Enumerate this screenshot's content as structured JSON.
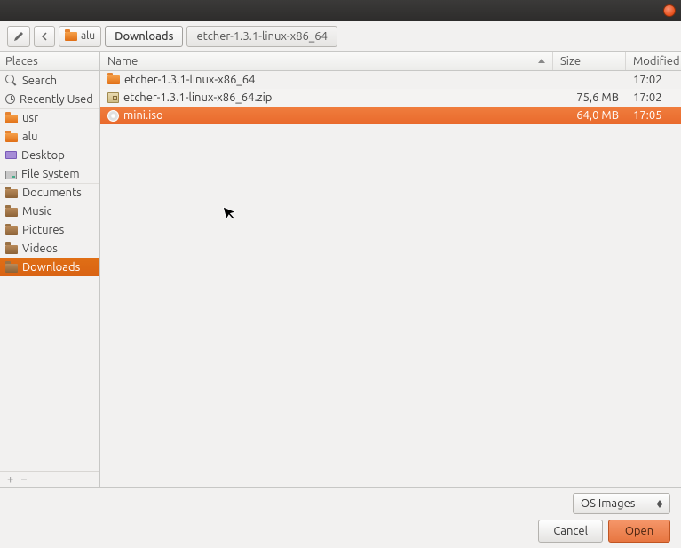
{
  "path": {
    "parent": "alu",
    "current": "Downloads",
    "full": "etcher-1.3.1-linux-x86_64"
  },
  "sidebar": {
    "header": "Places",
    "items": [
      {
        "label": "Search"
      },
      {
        "label": "Recently Used"
      },
      {
        "label": "usr"
      },
      {
        "label": "alu"
      },
      {
        "label": "Desktop"
      },
      {
        "label": "File System"
      },
      {
        "label": "Documents"
      },
      {
        "label": "Music"
      },
      {
        "label": "Pictures"
      },
      {
        "label": "Videos"
      },
      {
        "label": "Downloads"
      }
    ]
  },
  "columns": {
    "name": "Name",
    "size": "Size",
    "modified": "Modified"
  },
  "files": [
    {
      "name": "etcher-1.3.1-linux-x86_64",
      "size": "",
      "modified": "17:02"
    },
    {
      "name": "etcher-1.3.1-linux-x86_64.zip",
      "size": "75,6 MB",
      "modified": "17:02"
    },
    {
      "name": "mini.iso",
      "size": "64,0 MB",
      "modified": "17:05"
    }
  ],
  "filter": {
    "label": "OS Images"
  },
  "buttons": {
    "cancel": "Cancel",
    "open": "Open"
  }
}
